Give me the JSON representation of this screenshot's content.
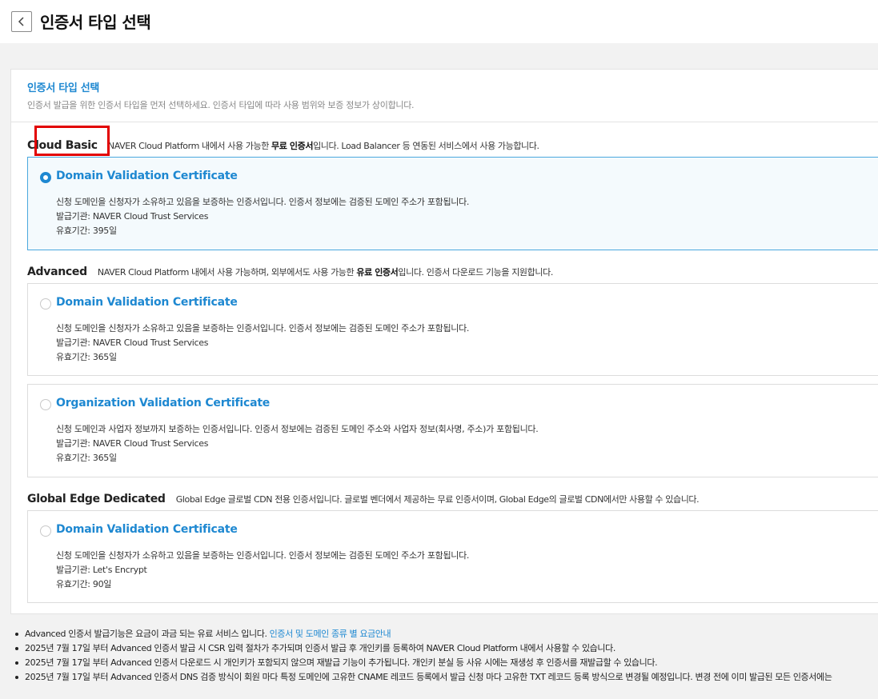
{
  "header": {
    "title": "인증서 타입 선택",
    "back_icon": "chevron-left-icon"
  },
  "panel": {
    "title": "인증서 타입 선택",
    "description": "인증서 발급을 위한 인증서 타입을 먼저 선택하세요. 인증서 타입에 따라 사용 범위와 보증 정보가 상이합니다."
  },
  "sections": [
    {
      "name": "Cloud Basic",
      "desc_pre": "NAVER Cloud Platform 내에서 사용 가능한 ",
      "desc_bold": "무료 인증서",
      "desc_post": "입니다. Load Balancer 등 연동된 서비스에서 사용 가능합니다.",
      "cards": [
        {
          "title": "Domain Validation Certificate",
          "selected": true,
          "desc": "신청 도메인을 신청자가 소유하고 있음을 보증하는 인증서입니다. 인증서 정보에는 검증된 도메인 주소가 포함됩니다.",
          "issuer": "발급기관: NAVER Cloud Trust Services",
          "validity": "유효기간: 395일"
        }
      ]
    },
    {
      "name": "Advanced",
      "desc_pre": "NAVER Cloud Platform 내에서 사용 가능하며, 외부에서도 사용 가능한 ",
      "desc_bold": "유료 인증서",
      "desc_post": "입니다. 인증서 다운로드 기능을 지원합니다.",
      "cards": [
        {
          "title": "Domain Validation Certificate",
          "selected": false,
          "desc": "신청 도메인을 신청자가 소유하고 있음을 보증하는 인증서입니다. 인증서 정보에는 검증된 도메인 주소가 포함됩니다.",
          "issuer": "발급기관: NAVER Cloud Trust Services",
          "validity": "유효기간: 365일"
        },
        {
          "title": "Organization Validation Certificate",
          "selected": false,
          "desc": "신청 도메인과 사업자 정보까지 보증하는 인증서입니다. 인증서 정보에는 검증된 도메인 주소와 사업자 정보(회사명, 주소)가 포함됩니다.",
          "issuer": "발급기관: NAVER Cloud Trust Services",
          "validity": "유효기간: 365일"
        }
      ]
    },
    {
      "name": "Global Edge Dedicated",
      "desc_pre": "Global Edge 글로벌 CDN 전용 인증서입니다. 글로벌 벤더에서 제공하는 무료 인증서이며, Global Edge의 글로벌 CDN에서만 사용할 수 있습니다.",
      "desc_bold": "",
      "desc_post": "",
      "cards": [
        {
          "title": "Domain Validation Certificate",
          "selected": false,
          "desc": "신청 도메인을 신청자가 소유하고 있음을 보증하는 인증서입니다. 인증서 정보에는 검증된 도메인 주소가 포함됩니다.",
          "issuer": "발급기관: Let's Encrypt",
          "validity": "유효기간: 90일"
        }
      ]
    }
  ],
  "notes": {
    "n1_text": "Advanced 인증서 발급기능은 요금이 과금 되는 유료 서비스 입니다. ",
    "n1_link": "인증서 및 도메인 종류 별 요금안내",
    "n2": "2025년 7월 17일 부터 Advanced 인증서 발급 시 CSR 입력 절차가 추가되며 인증서 발급 후 개인키를 등록하여 NAVER Cloud Platform 내에서 사용할 수 있습니다.",
    "n3": "2025년 7월 17일 부터 Advanced 인증서 다운로드 시 개인키가 포함되지 않으며 재발급 기능이 추가됩니다. 개인키 분실 등 사유 시에는 재생성 후 인증서를 재발급할 수 있습니다.",
    "n4": "2025년 7월 17일 부터 Advanced 인증서 DNS 검증 방식이 회원 마다 특정 도메인에 고유한 CNAME 레코드 등록에서 발급 신청 마다 고유한 TXT 레코드 등록 방식으로 변경될 예정입니다. 변경 전에 이미 발급된 모든 인증서에는"
  },
  "colors": {
    "accent": "#1e88d1",
    "highlight": "#e20000",
    "selected_bg": "#f4fafd"
  }
}
